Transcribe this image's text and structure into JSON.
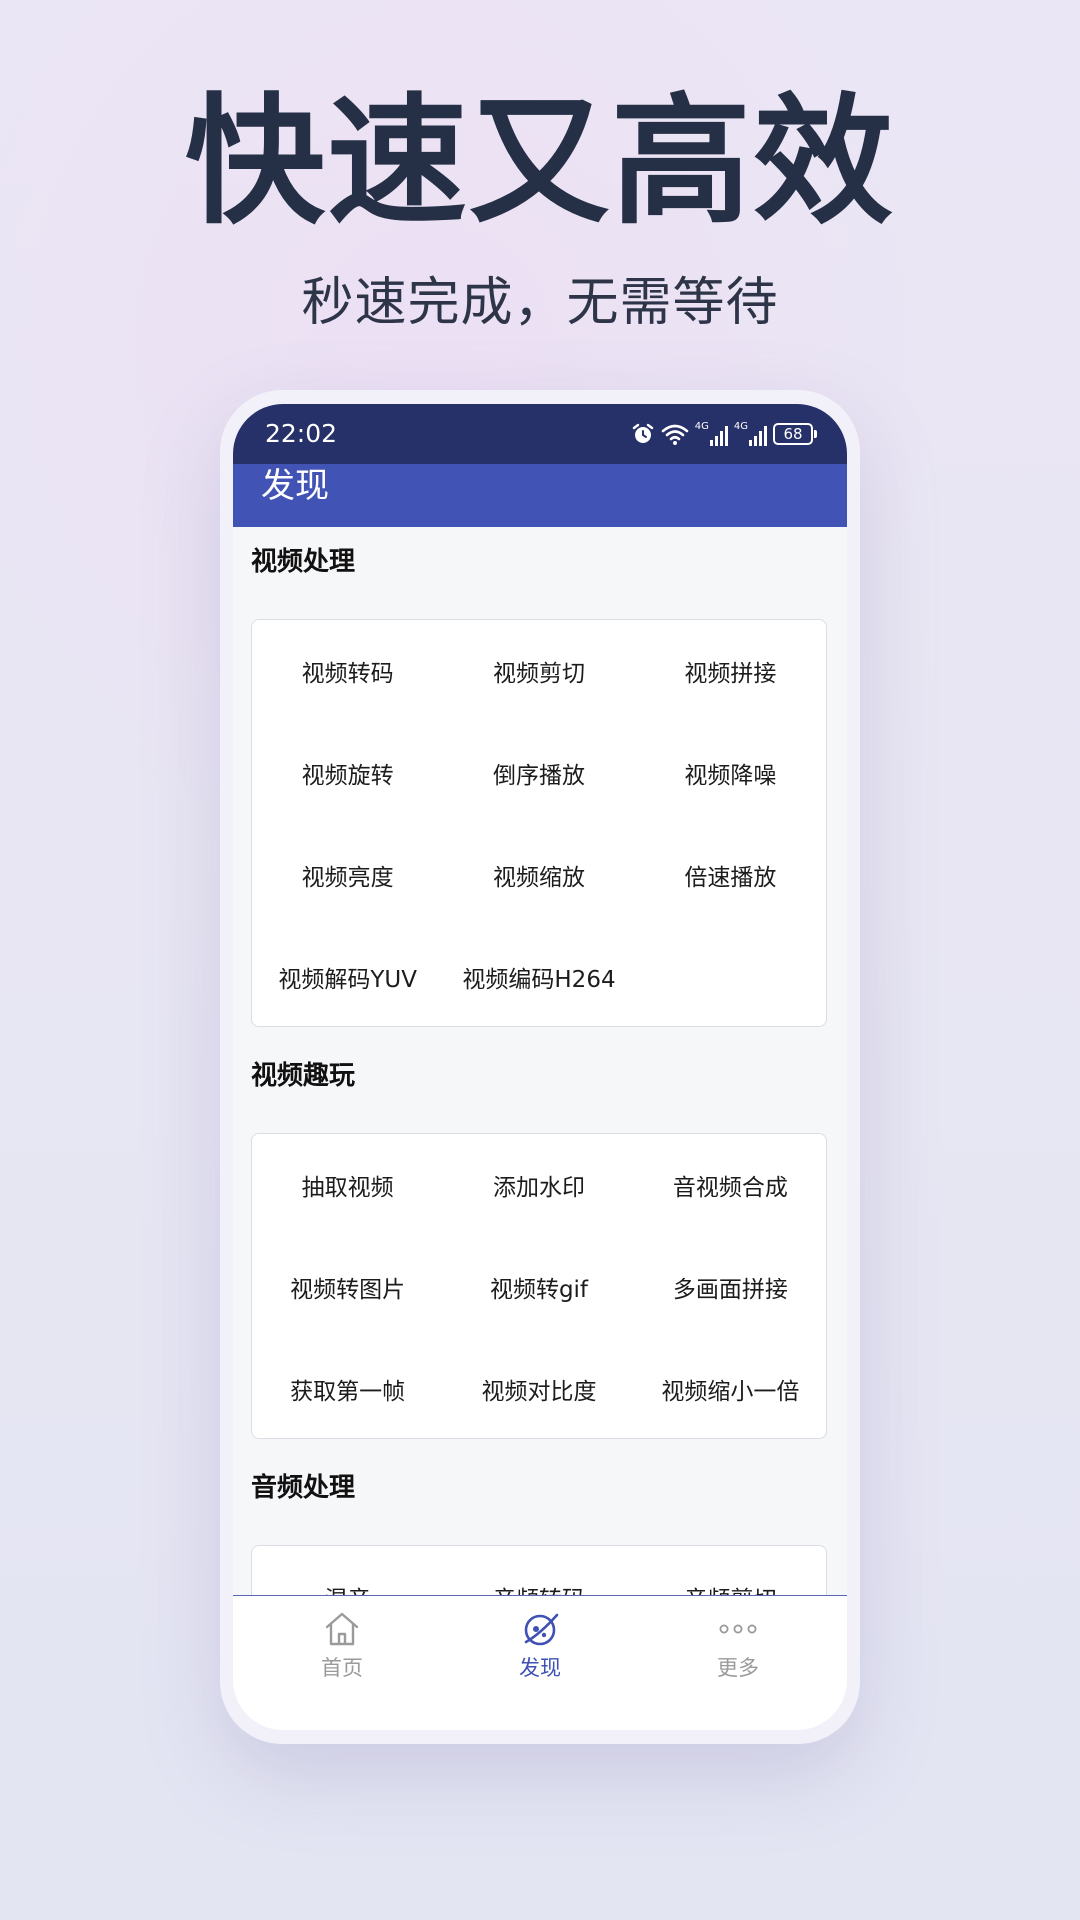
{
  "promo": {
    "headline": "快速又高效",
    "subheadline": "秒速完成，无需等待"
  },
  "status_bar": {
    "time": "22:02",
    "network_1": "4G",
    "network_2": "4G",
    "battery": "68"
  },
  "app_bar": {
    "title": "发现"
  },
  "sections": [
    {
      "title": "视频处理",
      "items": [
        "视频转码",
        "视频剪切",
        "视频拼接",
        "视频旋转",
        "倒序播放",
        "视频降噪",
        "视频亮度",
        "视频缩放",
        "倍速播放",
        "视频解码YUV",
        "视频编码H264"
      ]
    },
    {
      "title": "视频趣玩",
      "items": [
        "抽取视频",
        "添加水印",
        "音视频合成",
        "视频转图片",
        "视频转gif",
        "多画面拼接",
        "获取第一帧",
        "视频对比度",
        "视频缩小一倍"
      ]
    },
    {
      "title": "音频处理",
      "items": [
        "混音",
        "音频转码",
        "音频剪切"
      ]
    }
  ],
  "bottom_nav": {
    "items": [
      {
        "label": "首页",
        "icon": "home-icon",
        "active": false
      },
      {
        "label": "发现",
        "icon": "discover-icon",
        "active": true
      },
      {
        "label": "更多",
        "icon": "more-icon",
        "active": false
      }
    ]
  },
  "colors": {
    "status_bar": "#263069",
    "app_bar": "#4153b5",
    "active_tab": "#3f51b5",
    "inactive_tab": "#9a9a9a"
  }
}
